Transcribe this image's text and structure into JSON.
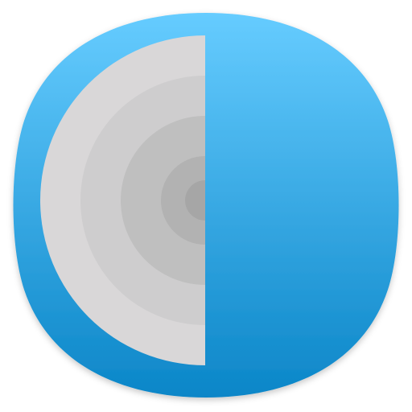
{
  "icon": {
    "name": "app-icon",
    "colors": {
      "background_top": "#66CCFF",
      "background_bottom": "#0B86C8",
      "ring_outer": "#D9D7D8",
      "ring_2": "#CECDCE",
      "ring_3": "#BFBFBF",
      "ring_4": "#B2B2B2",
      "ring_core": "#A6A6A6"
    },
    "ring_count": 5
  }
}
